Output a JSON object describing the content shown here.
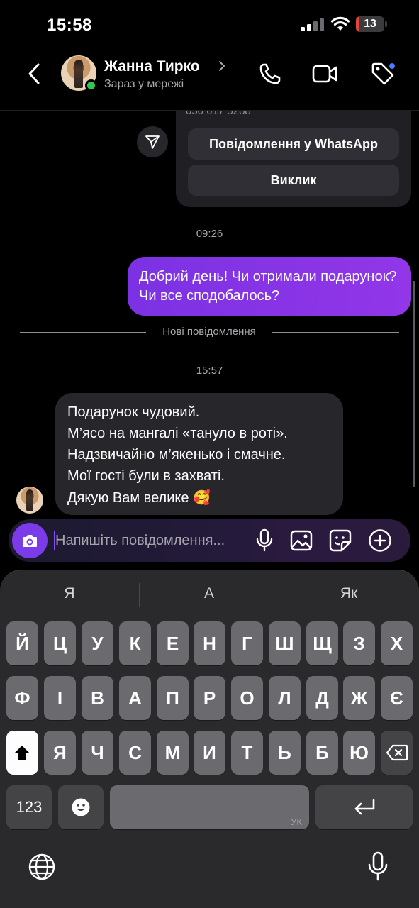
{
  "status_bar": {
    "time": "15:58",
    "battery": "13",
    "battery_level": 0.13
  },
  "header": {
    "contact_name": "Жанна Тирко",
    "contact_status": "Зараз у мережі"
  },
  "chat": {
    "contact_card": {
      "phone_partial": "050 017 5288",
      "whatsapp_button": "Повідомлення у WhatsApp",
      "call_button": "Виклик"
    },
    "timestamp_1": "09:26",
    "outgoing_message": "Добрий день! Чи отримали подарунок? Чи все сподобалось?",
    "divider_label": "Нові повідомлення",
    "timestamp_2": "15:57",
    "incoming_lines": [
      "Подарунок чудовий.",
      "М’ясо на мангалі «тануло в роті».",
      "Надзвичайно м’якенько і смачне.",
      "Мої гості були в захваті.",
      "Дякую Вам велике"
    ],
    "incoming_emoji": "🥰"
  },
  "composer": {
    "placeholder": "Напишіть повідомлення..."
  },
  "keyboard": {
    "suggestions": [
      "Я",
      "А",
      "Як"
    ],
    "row1": [
      "Й",
      "Ц",
      "У",
      "К",
      "Е",
      "Н",
      "Г",
      "Ш",
      "Щ",
      "З",
      "Х"
    ],
    "row2": [
      "Ф",
      "І",
      "В",
      "А",
      "П",
      "Р",
      "О",
      "Л",
      "Д",
      "Ж",
      "Є"
    ],
    "row3": [
      "Я",
      "Ч",
      "С",
      "М",
      "И",
      "Т",
      "Ь",
      "Б",
      "Ю"
    ],
    "numbers_key": "123",
    "space_language": "УК"
  },
  "icons": {
    "back": "chevron-left-icon",
    "phone": "phone-icon",
    "video": "video-camera-icon",
    "tag": "tag-icon",
    "share": "send-icon",
    "camera": "camera-icon",
    "mic": "microphone-icon",
    "gallery": "image-icon",
    "sticker": "sticker-icon",
    "plus": "plus-circle-icon",
    "shift": "shift-icon",
    "delete": "backspace-icon",
    "emoji": "emoji-icon",
    "return": "return-icon",
    "globe": "globe-icon",
    "dictation": "microphone-icon"
  },
  "colors": {
    "accent_purple": "#7c3be8",
    "outgoing_bubble": "#8a35e6",
    "online_dot": "#2ec94b",
    "tag_badge": "#4a7bff",
    "battery_low": "#e5443b"
  }
}
